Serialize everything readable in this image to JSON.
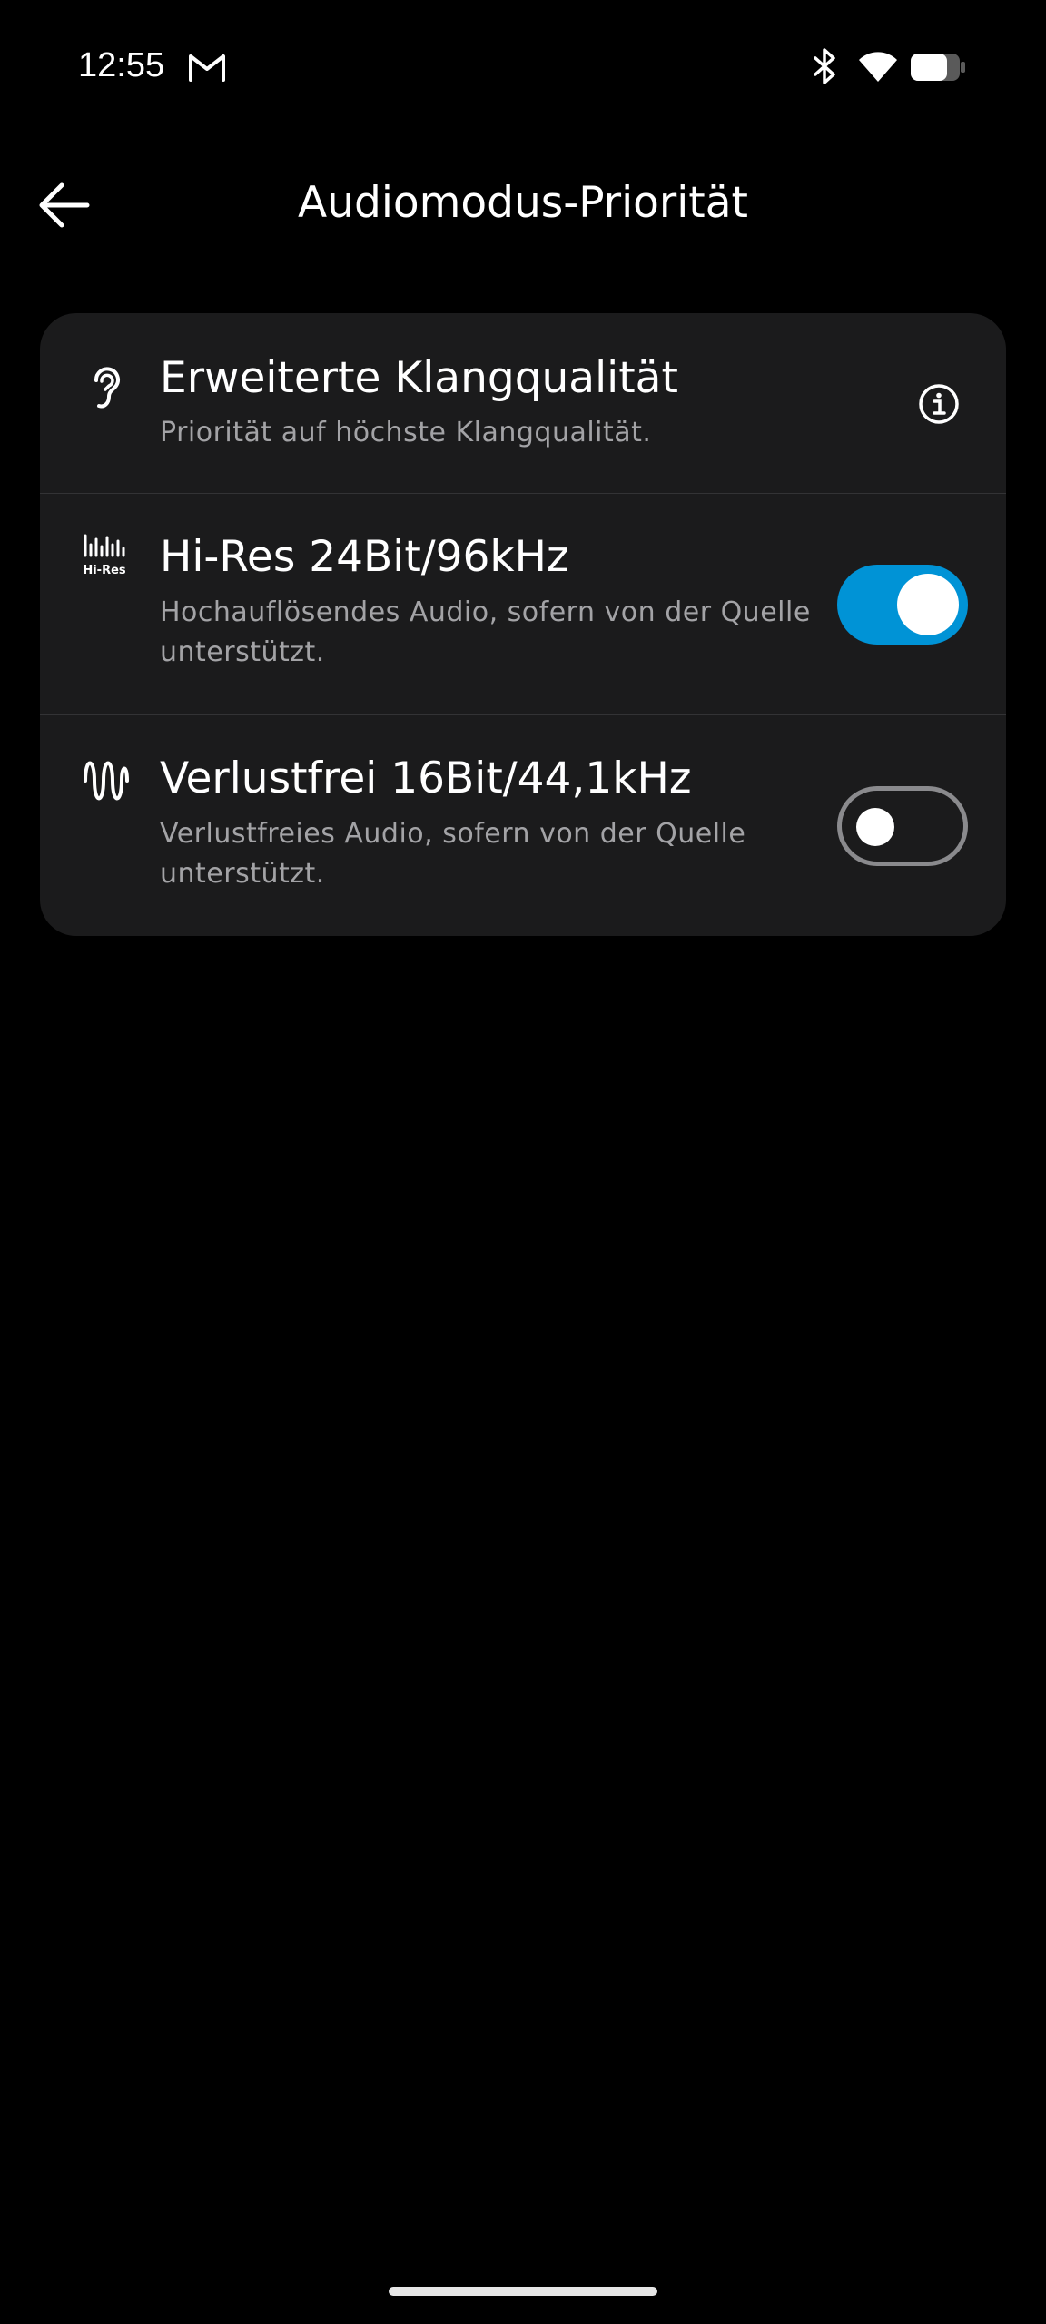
{
  "status_bar": {
    "time": "12:55",
    "icons": [
      "gmail-icon",
      "bluetooth-icon",
      "wifi-icon",
      "battery-icon"
    ]
  },
  "header": {
    "title": "Audiomodus-Priorität",
    "back_icon": "arrow-left-icon"
  },
  "options": [
    {
      "icon": "ear-icon",
      "title": "Erweiterte Klangqualität",
      "description": "Priorität auf höchste Klangqualität.",
      "control": "info-icon"
    },
    {
      "icon": "hi-res-icon",
      "icon_text": "Hi-Res",
      "title": "Hi-Res 24Bit/96kHz",
      "description": "Hochauflösendes Audio, sofern von der Quelle unterstützt.",
      "control": "toggle",
      "enabled": true
    },
    {
      "icon": "lossless-wave-icon",
      "title": "Verlustfrei 16Bit/44,1kHz",
      "description": "Verlustfreies Audio, sofern von der Quelle unterstützt.",
      "control": "toggle",
      "enabled": false
    }
  ],
  "colors": {
    "background": "#000000",
    "card": "#1b1b1c",
    "accent": "#0093d6",
    "secondary_text": "#a3a3a6"
  }
}
